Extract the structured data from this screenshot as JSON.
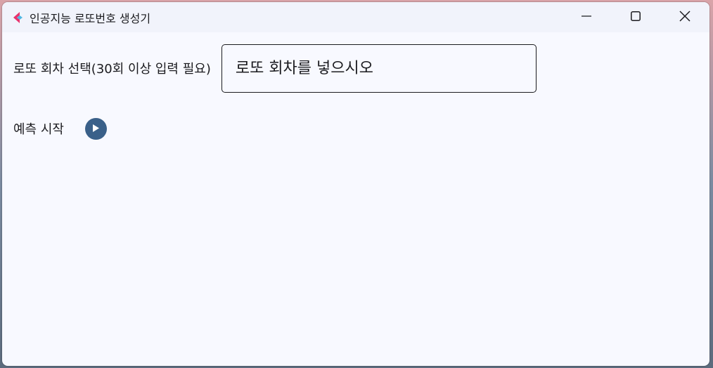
{
  "window": {
    "title": "인공지능 로또번호 생성기",
    "icon": "app-logo-icon",
    "controls": {
      "minimize_icon": "minimize-icon",
      "maximize_icon": "maximize-icon",
      "close_icon": "close-icon"
    }
  },
  "form": {
    "round_label": "로또 회차 선택(30회 이상 입력 필요)",
    "round_input": {
      "value": "",
      "placeholder": "로또 회차를 넣으시오"
    },
    "start_label": "예측 시작",
    "start_icon": "play-circle-icon"
  },
  "colors": {
    "accent": "#3a6089",
    "window_bg": "#f8f9ff",
    "titlebar_bg": "#f1f3fb",
    "text": "#1b1b1f",
    "logo_pink": "#e8336d",
    "logo_blue": "#4fb7e3"
  }
}
